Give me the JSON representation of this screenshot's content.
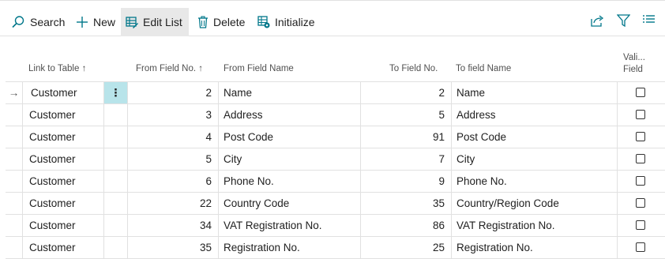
{
  "toolbar": {
    "search_label": "Search",
    "new_label": "New",
    "edit_list_label": "Edit List",
    "delete_label": "Delete",
    "initialize_label": "Initialize"
  },
  "icons": {
    "search": "search-icon",
    "new": "plus-icon",
    "edit_list": "edit-list-icon",
    "delete": "trash-icon",
    "initialize": "initialize-icon",
    "share": "share-icon",
    "filter": "filter-icon",
    "list_view": "list-view-icon"
  },
  "colors": {
    "accent": "#00778a",
    "selected_cell": "#b8e4ea",
    "active_button": "#e8e8e8"
  },
  "columns": {
    "link_to_table": "Link to Table",
    "link_to_table_sort": "↑",
    "from_field_no": "From Field No.",
    "from_field_no_sort": "↑",
    "from_field_name": "From Field Name",
    "to_field_no": "To Field No.",
    "to_field_name": "To field Name",
    "validate_line1": "Vali...",
    "validate_line2": "Field"
  },
  "rows": [
    {
      "marker": "→",
      "link_to_table": "Customer",
      "menu": "⋮",
      "from_no": "2",
      "from_name": "Name",
      "to_no": "2",
      "to_name": "Name",
      "validate": false
    },
    {
      "marker": "",
      "link_to_table": "Customer",
      "menu": "",
      "from_no": "3",
      "from_name": "Address",
      "to_no": "5",
      "to_name": "Address",
      "validate": false
    },
    {
      "marker": "",
      "link_to_table": "Customer",
      "menu": "",
      "from_no": "4",
      "from_name": "Post Code",
      "to_no": "91",
      "to_name": "Post Code",
      "validate": false
    },
    {
      "marker": "",
      "link_to_table": "Customer",
      "menu": "",
      "from_no": "5",
      "from_name": "City",
      "to_no": "7",
      "to_name": "City",
      "validate": false
    },
    {
      "marker": "",
      "link_to_table": "Customer",
      "menu": "",
      "from_no": "6",
      "from_name": "Phone No.",
      "to_no": "9",
      "to_name": "Phone No.",
      "validate": false
    },
    {
      "marker": "",
      "link_to_table": "Customer",
      "menu": "",
      "from_no": "22",
      "from_name": "Country Code",
      "to_no": "35",
      "to_name": "Country/Region Code",
      "validate": false
    },
    {
      "marker": "",
      "link_to_table": "Customer",
      "menu": "",
      "from_no": "34",
      "from_name": "VAT Registration No.",
      "to_no": "86",
      "to_name": "VAT Registration No.",
      "validate": false
    },
    {
      "marker": "",
      "link_to_table": "Customer",
      "menu": "",
      "from_no": "35",
      "from_name": "Registration No.",
      "to_no": "25",
      "to_name": "Registration No.",
      "validate": false
    }
  ]
}
